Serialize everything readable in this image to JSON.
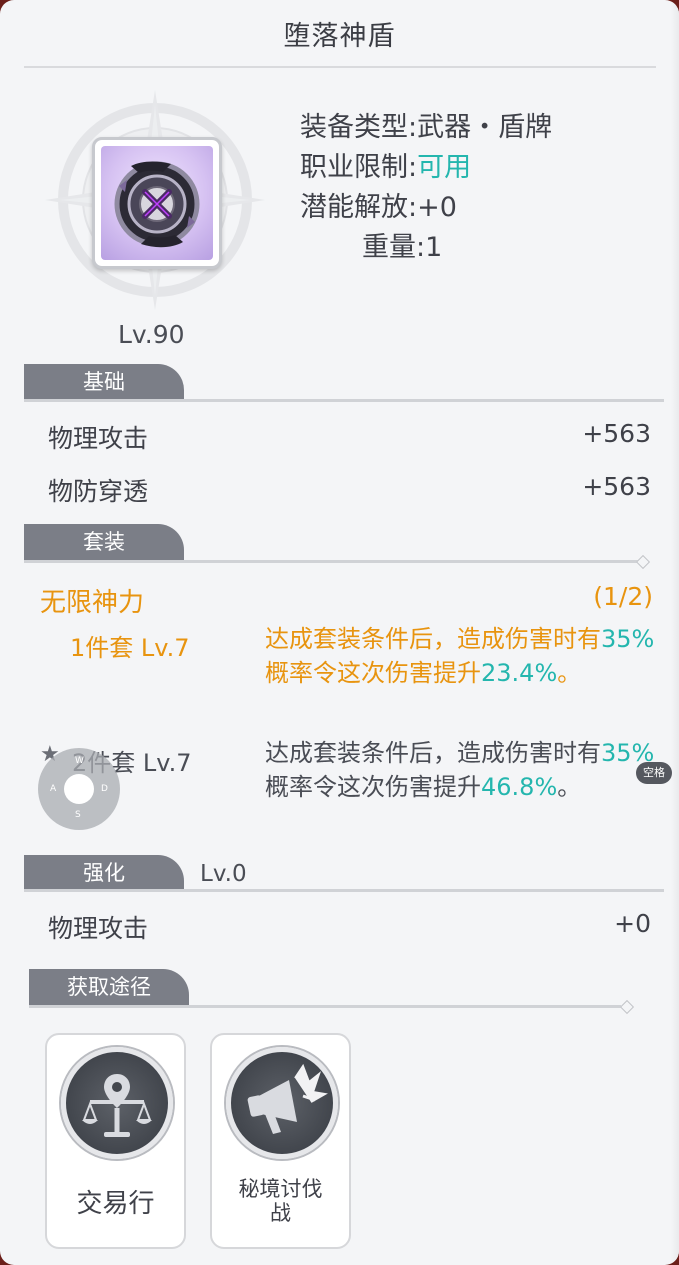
{
  "title": "堕落神盾",
  "item": {
    "level": "Lv.90",
    "icon": "dark-shield-icon"
  },
  "info": {
    "type_label": "装备类型:",
    "type_value": "武器・盾牌",
    "class_label": "职业限制:",
    "class_value": "可用",
    "potential_label": "潜能解放:",
    "potential_value": "+0",
    "weight_label": "重量:",
    "weight_value": "1"
  },
  "basic": {
    "tab": "基础",
    "stats": [
      {
        "name": "物理攻击",
        "value": "+563"
      },
      {
        "name": "物防穿透",
        "value": "+563"
      }
    ]
  },
  "set": {
    "tab": "套装",
    "name": "无限神力",
    "count": "(1/2)",
    "bonus1_label": "1件套 Lv.7",
    "bonus1_desc_a": "达成套装条件后，造成伤害时有",
    "bonus1_pct": "35%",
    "bonus1_desc_b": "概率令这次伤害提升",
    "bonus1_value": "23.4%",
    "bonus1_end": "。",
    "bonus2_label": "2件套 Lv.7",
    "bonus2_desc_a": "达成套装条件后，造成伤害时有",
    "bonus2_pct": "35%",
    "bonus2_desc_b": "概率令这次伤害提升",
    "bonus2_value": "46.8%",
    "bonus2_end": "。"
  },
  "enhance": {
    "tab": "强化",
    "level": "Lv.0",
    "stats": [
      {
        "name": "物理攻击",
        "value": "+0"
      }
    ]
  },
  "source": {
    "tab": "获取途径",
    "items": [
      {
        "label": "交易行",
        "icon": "scales-icon"
      },
      {
        "label": "秘境讨伐战",
        "icon": "megaphone-icon"
      }
    ]
  },
  "overlay": {
    "joystick_keys": [
      "W",
      "A",
      "S",
      "D"
    ],
    "badge": "空格"
  },
  "colors": {
    "accent_orange": "#e8940f",
    "accent_teal": "#24b6ae",
    "tab_gray": "#7b7e87"
  }
}
